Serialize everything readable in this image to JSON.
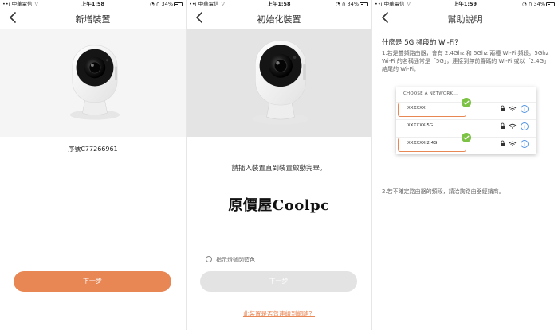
{
  "status": {
    "carrier": "中華電信",
    "battery": "34%",
    "times": [
      "上午1:58",
      "上午1:58",
      "上午1:59"
    ]
  },
  "screen1": {
    "title": "新增裝置",
    "serial": "序號C77266961",
    "next_button": "下一步"
  },
  "screen2": {
    "title": "初始化裝置",
    "instruction": "請插入裝置直到裝置啟動完畢。",
    "watermark": "原價屋Coolpc",
    "checkbox_label": "指示燈號閃藍色",
    "next_button": "下一步",
    "link": "此裝置是否曾連線到網路？"
  },
  "screen3": {
    "title": "幫助說明",
    "question": "什麼是 5G 頻段的 Wi-Fi？",
    "answer1": "1.若是雙頻路由器，會有 2.4Ghz 和 5Ghz 兩種 Wi-Fi 頻段。5Ghz Wi-Fi 的名稱通常是「5G」，連接到無前置碼的 Wi-Fi 或以「2.4G」結尾的 Wi-Fi。",
    "network_header": "CHOOSE A NETWORK...",
    "networks": [
      {
        "name": "XXXXXX"
      },
      {
        "name": "XXXXXX-5G"
      },
      {
        "name": "XXXXXX-2.4G"
      }
    ],
    "answer2": "2.若不確定路由器的頻段，請洽詢路由器經銷商。"
  },
  "colors": {
    "accent": "#e88654",
    "check": "#7cc245",
    "info_blue": "#4a90e2"
  }
}
